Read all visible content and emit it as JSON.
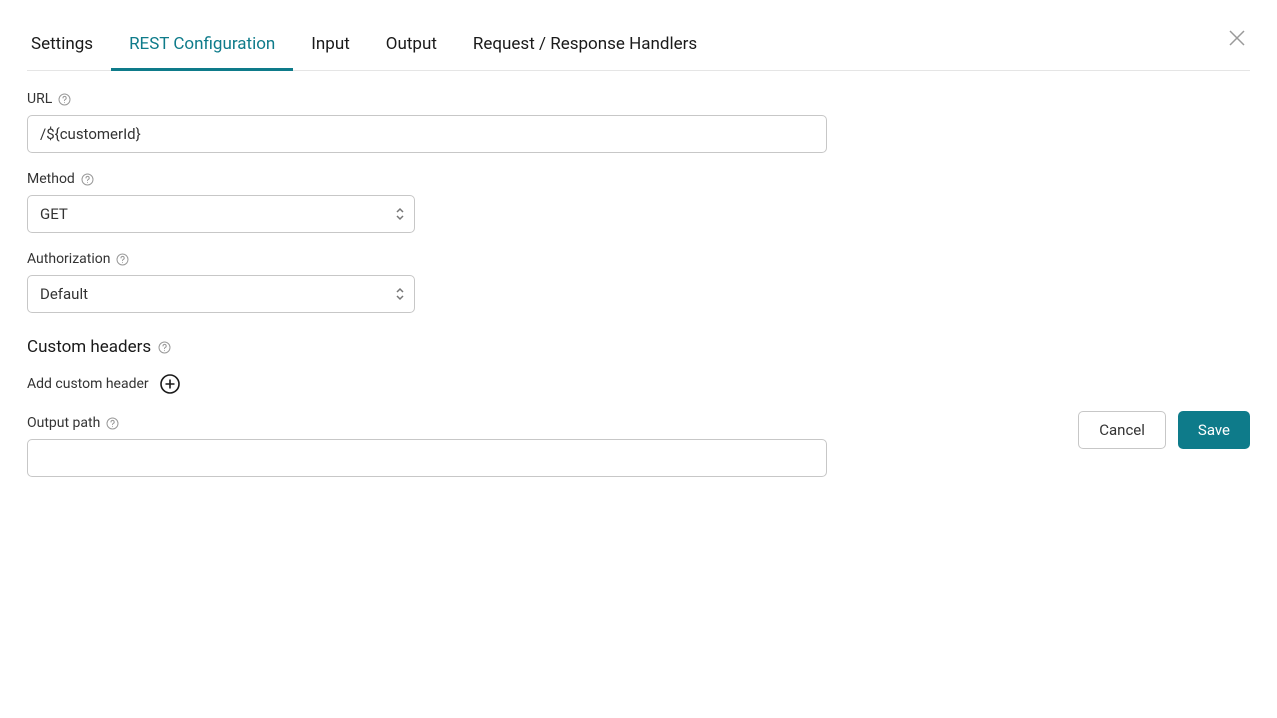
{
  "tabs": [
    {
      "label": "Settings",
      "active": false
    },
    {
      "label": "REST Configuration",
      "active": true
    },
    {
      "label": "Input",
      "active": false
    },
    {
      "label": "Output",
      "active": false
    },
    {
      "label": "Request / Response Handlers",
      "active": false
    }
  ],
  "form": {
    "url_label": "URL",
    "url_value": "/${customerId}",
    "method_label": "Method",
    "method_value": "GET",
    "authorization_label": "Authorization",
    "authorization_value": "Default",
    "custom_headers_title": "Custom headers",
    "add_custom_header_label": "Add custom header",
    "output_path_label": "Output path",
    "output_path_value": ""
  },
  "footer": {
    "cancel_label": "Cancel",
    "save_label": "Save"
  },
  "colors": {
    "accent": "#0e7b8a",
    "border": "#c7c7c7",
    "text": "#1a1a1a"
  }
}
